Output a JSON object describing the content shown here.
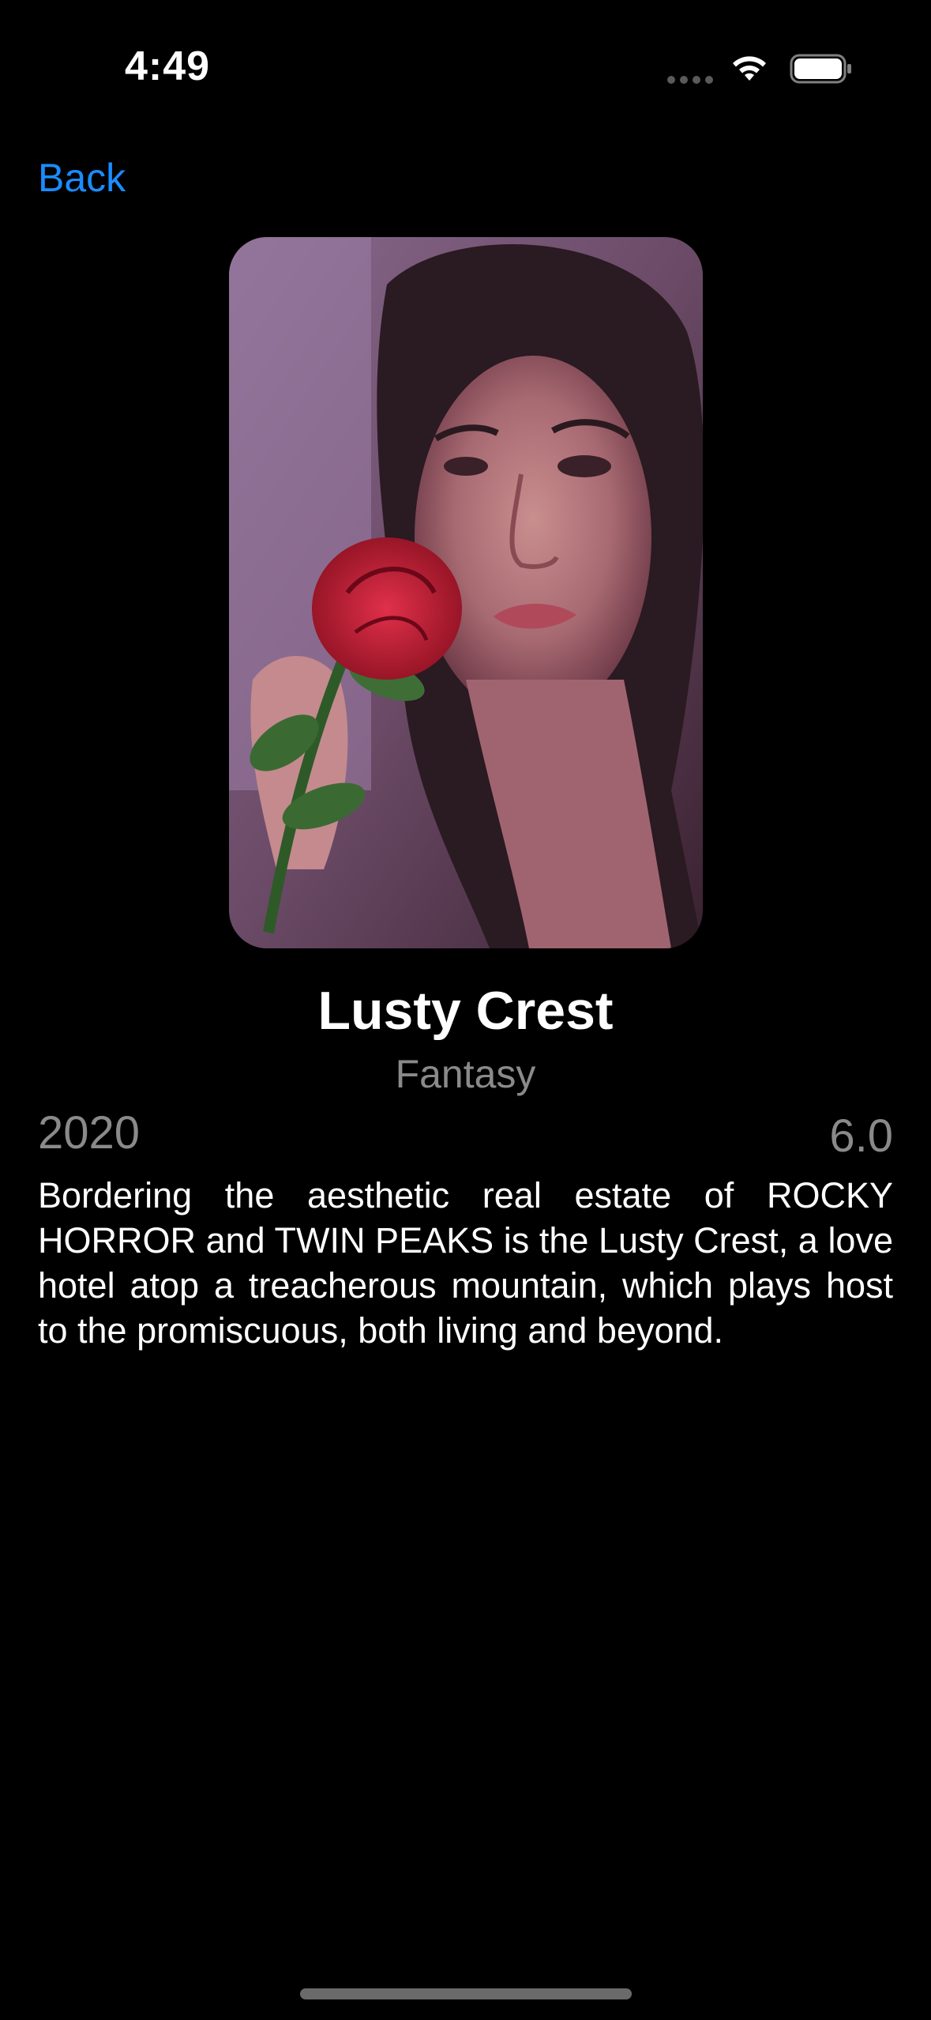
{
  "status_bar": {
    "time": "4:49"
  },
  "nav": {
    "back_label": "Back"
  },
  "movie": {
    "title": "Lusty Crest",
    "genre": "Fantasy",
    "year": "2020",
    "rating": "6.0",
    "description": "Bordering the aesthetic real estate of ROCKY HORROR and TWIN PEAKS is the Lusty Crest, a love hotel atop a treacherous mountain, which plays host to the promiscuous, both living and beyond."
  },
  "colors": {
    "background": "#000000",
    "accent": "#1a8cff",
    "secondary_text": "#8a8a8a"
  }
}
